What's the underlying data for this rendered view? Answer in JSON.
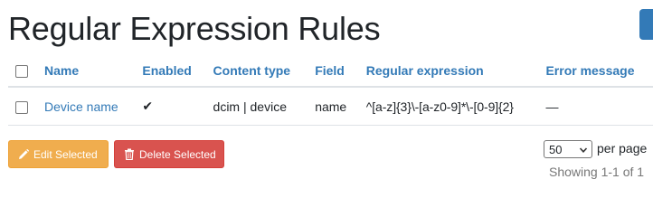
{
  "page": {
    "title": "Regular Expression Rules"
  },
  "table": {
    "headers": {
      "name": "Name",
      "enabled": "Enabled",
      "content_type": "Content type",
      "field": "Field",
      "regex": "Regular expression",
      "error": "Error message"
    },
    "rows": [
      {
        "name": "Device name",
        "enabled": "✔",
        "content_type": "dcim | device",
        "field": "name",
        "regex": "^[a-z]{3}\\-[a-z0-9]*\\-[0-9]{2}",
        "error": "—"
      }
    ]
  },
  "actions": {
    "edit_label": "Edit Selected",
    "delete_label": "Delete Selected"
  },
  "pagination": {
    "per_page_value": "50",
    "per_page_label": "per page",
    "showing": "Showing 1-1 of 1"
  },
  "colors": {
    "link": "#337ab7",
    "edit_button": "#f0ad4e",
    "delete_button": "#d9534f"
  },
  "icons": {
    "edit": "pencil-icon",
    "delete": "trash-icon",
    "select": "chevron-down-icon"
  }
}
